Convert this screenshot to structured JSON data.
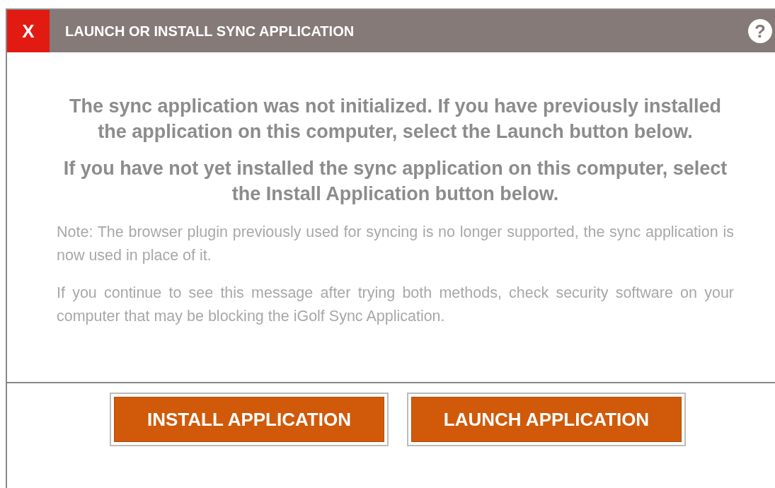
{
  "dialog": {
    "close_label": "X",
    "title": "LAUNCH OR INSTALL SYNC APPLICATION",
    "help_label": "?",
    "headings": [
      "The sync application was not initialized. If you have previously installed the application on this computer, select the Launch button below.",
      "If you have not yet installed the sync application on this computer, select the Install Application button below."
    ],
    "notes": [
      "Note: The browser plugin previously used for syncing is no longer supported, the sync application is now used in place of it.",
      "If you continue to see this message after trying both methods, check security software on your computer that may be blocking the iGolf Sync Application."
    ],
    "buttons": [
      "INSTALL APPLICATION",
      "LAUNCH APPLICATION"
    ]
  }
}
